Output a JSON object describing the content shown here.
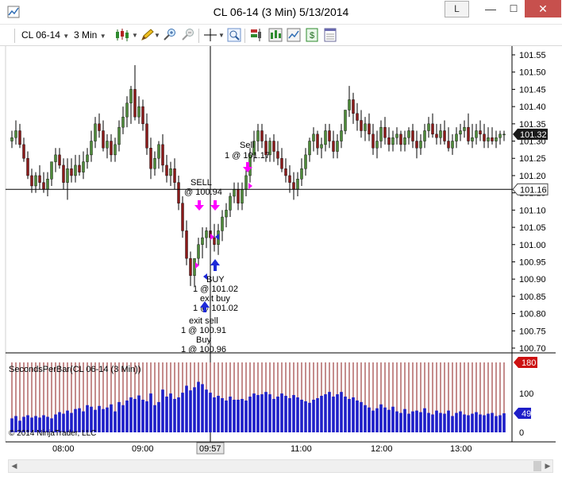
{
  "window": {
    "title": "CL 06-14 (3 Min)  5/13/2014",
    "l_button": "L",
    "min_glyph": "—",
    "max_glyph": "☐",
    "close_glyph": "✕"
  },
  "toolbar": {
    "instrument": "CL 06-14",
    "interval": "3 Min"
  },
  "price_panel": {
    "y_labels": [
      "101.55",
      "101.50",
      "101.45",
      "101.40",
      "101.35",
      "101.30",
      "101.25",
      "101.20",
      "101.15",
      "101.10",
      "101.05",
      "101.00",
      "100.95",
      "100.90",
      "100.85",
      "100.80",
      "100.75",
      "100.70"
    ],
    "last_price": "101.32",
    "crosshair_price": "101.16",
    "annotations": [
      {
        "id": "sell-top",
        "text": "Sell"
      },
      {
        "id": "sell-top-qty",
        "text": "1 @ 101.17"
      },
      {
        "id": "sell-caps",
        "text": "SELL"
      },
      {
        "id": "sell-caps-qty",
        "text": "@ 100.94"
      },
      {
        "id": "buy-caps",
        "text": "BUY"
      },
      {
        "id": "buy-caps-qty",
        "text": "1 @ 101.02"
      },
      {
        "id": "exit-buy",
        "text": "exit buy"
      },
      {
        "id": "exit-buy-qty",
        "text": "1 @ 101.02"
      },
      {
        "id": "exit-sell",
        "text": "exit sell"
      },
      {
        "id": "exit-sell-qty",
        "text": "1 @ 100.91"
      },
      {
        "id": "buy",
        "text": "Buy"
      },
      {
        "id": "buy-qty",
        "text": "1 @ 100.96"
      }
    ]
  },
  "indicator_panel": {
    "label": "SecondsPerBar(CL 06-14 (3 Min))",
    "copyright": "© 2014 NinjaTrader, LLC",
    "y_labels": [
      "100",
      "0"
    ],
    "max_value": "180",
    "current_value": "49"
  },
  "time_axis": {
    "labels": [
      "08:00",
      "09:00",
      "11:00",
      "12:00",
      "13:00"
    ],
    "crosshair_time": "09:57"
  },
  "colors": {
    "up_candle": "#4e8a3a",
    "down_candle": "#8b1a1a",
    "buy_arrow": "#1e2ad8",
    "sell_arrow": "#ff00ff",
    "indicator_bars": "#1e1ec8",
    "ref_line": "#8b1a1a",
    "close_button": "#c7504d"
  },
  "chart_data": [
    {
      "type": "candlestick",
      "x": [
        "07:27",
        "07:30",
        "07:33",
        "07:36",
        "07:39",
        "07:42",
        "07:45",
        "07:48",
        "07:51",
        "07:54",
        "07:57",
        "08:00",
        "08:03",
        "08:06",
        "08:09",
        "08:12",
        "08:15",
        "08:18",
        "08:21",
        "08:24",
        "08:27",
        "08:30",
        "08:33",
        "08:36",
        "08:39",
        "08:42",
        "08:45",
        "08:48",
        "08:51",
        "08:54",
        "08:57",
        "09:00",
        "09:03",
        "09:06",
        "09:09",
        "09:12",
        "09:15",
        "09:18",
        "09:21",
        "09:24",
        "09:27",
        "09:30",
        "09:33",
        "09:36",
        "09:39",
        "09:42",
        "09:45",
        "09:48",
        "09:51",
        "09:54",
        "09:57",
        "10:00",
        "10:03",
        "10:06",
        "10:09",
        "10:12",
        "10:15",
        "10:18",
        "10:21",
        "10:24",
        "10:27",
        "10:30",
        "10:33",
        "10:36",
        "10:39",
        "10:42",
        "10:45",
        "10:48",
        "10:51",
        "10:54",
        "10:57",
        "11:00",
        "11:03",
        "11:06",
        "11:09",
        "11:12",
        "11:15",
        "11:18",
        "11:21",
        "11:24",
        "11:27",
        "11:30",
        "11:33",
        "11:36",
        "11:39",
        "11:42",
        "11:45",
        "11:48",
        "11:51",
        "11:54",
        "11:57",
        "12:00",
        "12:03",
        "12:06",
        "12:09",
        "12:12",
        "12:15",
        "12:18",
        "12:21",
        "12:24",
        "12:27",
        "12:30",
        "12:33",
        "12:36",
        "12:39",
        "12:42",
        "12:45",
        "12:48",
        "12:51",
        "12:54",
        "12:57",
        "13:00",
        "13:03",
        "13:06",
        "13:09",
        "13:12",
        "13:15",
        "13:18",
        "13:21",
        "13:24",
        "13:27",
        "13:30",
        "13:33",
        "13:36",
        "13:39"
      ],
      "open": [
        101.3,
        101.31,
        101.33,
        101.29,
        101.25,
        101.2,
        101.17,
        101.2,
        101.18,
        101.16,
        101.19,
        101.24,
        101.26,
        101.23,
        101.18,
        101.22,
        101.2,
        101.23,
        101.21,
        101.24,
        101.26,
        101.3,
        101.35,
        101.33,
        101.28,
        101.3,
        101.26,
        101.29,
        101.34,
        101.37,
        101.41,
        101.45,
        101.37,
        101.4,
        101.35,
        101.28,
        101.22,
        101.25,
        101.29,
        101.23,
        101.2,
        101.22,
        101.18,
        101.12,
        101.04,
        100.96,
        100.91,
        100.96,
        101.0,
        101.02,
        101.04,
        101.02,
        101.0,
        101.04,
        101.08,
        101.1,
        101.14,
        101.16,
        101.12,
        101.16,
        101.2,
        101.26,
        101.3,
        101.33,
        101.3,
        101.26,
        101.3,
        101.27,
        101.25,
        101.22,
        101.2,
        101.18,
        101.16,
        101.19,
        101.22,
        101.26,
        101.3,
        101.32,
        101.28,
        101.29,
        101.33,
        101.3,
        101.27,
        101.3,
        101.33,
        101.39,
        101.42,
        101.38,
        101.36,
        101.33,
        101.35,
        101.32,
        101.28,
        101.3,
        101.34,
        101.31,
        101.29,
        101.31,
        101.32,
        101.29,
        101.31,
        101.33,
        101.3,
        101.28,
        101.3,
        101.33,
        101.35,
        101.32,
        101.31,
        101.33,
        101.3,
        101.28,
        101.3,
        101.32,
        101.33,
        101.34,
        101.3,
        101.31,
        101.33,
        101.32,
        101.3,
        101.31,
        101.3,
        101.31,
        101.32
      ],
      "high": [
        101.33,
        101.36,
        101.35,
        101.31,
        101.27,
        101.22,
        101.21,
        101.23,
        101.21,
        101.21,
        101.24,
        101.28,
        101.28,
        101.25,
        101.25,
        101.25,
        101.26,
        101.26,
        101.27,
        101.28,
        101.33,
        101.37,
        101.38,
        101.36,
        101.32,
        101.32,
        101.31,
        101.36,
        101.4,
        101.43,
        101.46,
        101.52,
        101.43,
        101.42,
        101.38,
        101.31,
        101.27,
        101.3,
        101.32,
        101.26,
        101.24,
        101.25,
        101.2,
        101.14,
        101.07,
        100.98,
        100.96,
        101.02,
        101.05,
        101.05,
        101.07,
        101.06,
        101.06,
        101.1,
        101.12,
        101.15,
        101.18,
        101.18,
        101.18,
        101.22,
        101.28,
        101.33,
        101.35,
        101.35,
        101.32,
        101.31,
        101.32,
        101.3,
        101.28,
        101.25,
        101.23,
        101.21,
        101.21,
        101.25,
        101.28,
        101.31,
        101.34,
        101.33,
        101.31,
        101.35,
        101.35,
        101.33,
        101.32,
        101.35,
        101.39,
        101.46,
        101.44,
        101.41,
        101.39,
        101.37,
        101.38,
        101.35,
        101.33,
        101.36,
        101.37,
        101.34,
        101.33,
        101.34,
        101.33,
        101.33,
        101.34,
        101.35,
        101.33,
        101.32,
        101.35,
        101.37,
        101.38,
        101.35,
        101.35,
        101.36,
        101.34,
        101.32,
        101.34,
        101.35,
        101.36,
        101.38,
        101.35,
        101.35,
        101.36,
        101.35,
        101.34,
        101.34,
        101.33,
        101.33,
        101.33
      ],
      "low": [
        101.28,
        101.29,
        101.28,
        101.24,
        101.19,
        101.15,
        101.15,
        101.16,
        101.15,
        101.14,
        101.17,
        101.21,
        101.22,
        101.16,
        101.13,
        101.18,
        101.18,
        101.2,
        101.19,
        101.22,
        101.24,
        101.28,
        101.31,
        101.27,
        101.25,
        101.24,
        101.24,
        101.27,
        101.32,
        101.34,
        101.35,
        101.36,
        101.35,
        101.33,
        101.26,
        101.19,
        101.2,
        101.22,
        101.21,
        101.18,
        101.17,
        101.16,
        101.1,
        101.02,
        100.94,
        100.88,
        100.88,
        100.94,
        100.96,
        100.99,
        100.98,
        100.98,
        100.97,
        101.01,
        101.05,
        101.08,
        101.12,
        101.1,
        101.1,
        101.14,
        101.18,
        101.24,
        101.27,
        101.28,
        101.24,
        101.24,
        101.24,
        101.23,
        101.21,
        101.18,
        101.15,
        101.13,
        101.14,
        101.17,
        101.2,
        101.24,
        101.27,
        101.26,
        101.25,
        101.27,
        101.28,
        101.25,
        101.25,
        101.28,
        101.32,
        101.37,
        101.35,
        101.33,
        101.31,
        101.3,
        101.3,
        101.26,
        101.25,
        101.28,
        101.29,
        101.27,
        101.27,
        101.29,
        101.27,
        101.27,
        101.29,
        101.28,
        101.25,
        101.26,
        101.28,
        101.31,
        101.31,
        101.29,
        101.29,
        101.29,
        101.27,
        101.26,
        101.28,
        101.3,
        101.31,
        101.29,
        101.28,
        101.29,
        101.3,
        101.28,
        101.28,
        101.29,
        101.28,
        101.29,
        101.3
      ],
      "close": [
        101.31,
        101.33,
        101.29,
        101.25,
        101.2,
        101.17,
        101.2,
        101.18,
        101.16,
        101.19,
        101.24,
        101.26,
        101.23,
        101.18,
        101.22,
        101.2,
        101.23,
        101.21,
        101.24,
        101.26,
        101.3,
        101.35,
        101.33,
        101.28,
        101.3,
        101.26,
        101.29,
        101.34,
        101.37,
        101.41,
        101.45,
        101.37,
        101.4,
        101.35,
        101.28,
        101.22,
        101.25,
        101.29,
        101.23,
        101.2,
        101.22,
        101.18,
        101.12,
        101.04,
        100.96,
        100.91,
        100.96,
        101.0,
        101.02,
        101.04,
        101.02,
        101.0,
        101.04,
        101.08,
        101.1,
        101.14,
        101.16,
        101.12,
        101.16,
        101.2,
        101.26,
        101.3,
        101.33,
        101.3,
        101.26,
        101.3,
        101.27,
        101.25,
        101.22,
        101.2,
        101.18,
        101.16,
        101.19,
        101.22,
        101.26,
        101.3,
        101.32,
        101.28,
        101.29,
        101.33,
        101.3,
        101.27,
        101.3,
        101.33,
        101.39,
        101.42,
        101.38,
        101.36,
        101.33,
        101.35,
        101.32,
        101.28,
        101.3,
        101.34,
        101.31,
        101.29,
        101.31,
        101.32,
        101.29,
        101.31,
        101.33,
        101.3,
        101.28,
        101.3,
        101.33,
        101.35,
        101.32,
        101.31,
        101.33,
        101.3,
        101.28,
        101.3,
        101.32,
        101.33,
        101.34,
        101.3,
        101.31,
        101.33,
        101.32,
        101.3,
        101.31,
        101.3,
        101.31,
        101.32,
        101.32
      ],
      "ylim": [
        100.68,
        101.57
      ]
    },
    {
      "type": "bar",
      "title": "SecondsPerBar(CL 06-14 (3 Min))",
      "values": [
        36,
        42,
        30,
        40,
        44,
        38,
        42,
        38,
        44,
        40,
        36,
        46,
        52,
        48,
        56,
        50,
        60,
        62,
        54,
        70,
        66,
        58,
        68,
        60,
        64,
        72,
        54,
        78,
        70,
        82,
        90,
        86,
        95,
        84,
        80,
        100,
        70,
        78,
        110,
        92,
        100,
        86,
        90,
        102,
        120,
        108,
        116,
        130,
        124,
        110,
        102,
        90,
        94,
        88,
        82,
        92,
        84,
        84,
        86,
        82,
        92,
        100,
        96,
        98,
        104,
        98,
        86,
        92,
        100,
        94,
        88,
        96,
        90,
        84,
        80,
        76,
        84,
        88,
        94,
        98,
        104,
        92,
        98,
        104,
        92,
        86,
        90,
        82,
        78,
        70,
        64,
        56,
        62,
        72,
        64,
        58,
        66,
        54,
        50,
        60,
        48,
        54,
        56,
        52,
        62,
        50,
        46,
        56,
        50,
        48,
        56,
        42,
        50,
        54,
        46,
        44,
        48,
        52,
        46,
        44,
        48,
        50,
        42,
        44,
        49
      ],
      "reference": 180,
      "ylim": [
        0,
        190
      ]
    }
  ]
}
